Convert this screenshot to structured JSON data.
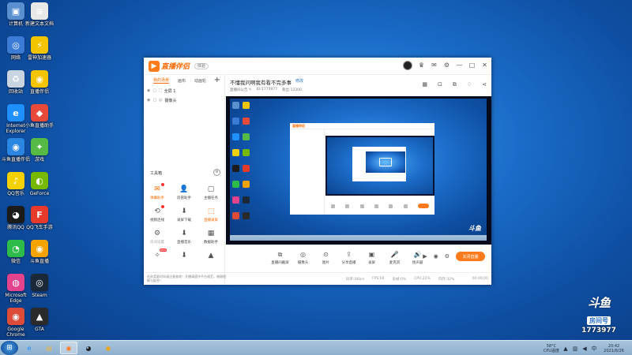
{
  "desktop": {
    "icons": [
      {
        "label": "计算机",
        "icon": "computer-icon",
        "color": "#5a8fd0",
        "glyph": "▣"
      },
      {
        "label": "新建文本文档",
        "icon": "text-doc-icon",
        "color": "#e8e8e8",
        "glyph": "≡"
      },
      {
        "label": "网络",
        "icon": "network-icon",
        "color": "#3a7bd5",
        "glyph": "◎"
      },
      {
        "label": "雷神加速器",
        "icon": "leishen-icon",
        "color": "#f3c400",
        "glyph": "⚡"
      },
      {
        "label": "回收站",
        "icon": "recycle-bin-icon",
        "color": "#c9d6e2",
        "glyph": "♻"
      },
      {
        "label": "直播伴侣",
        "icon": "live-companion-icon",
        "color": "#f5c400",
        "glyph": "◉"
      },
      {
        "label": "Internet Explorer",
        "icon": "ie-icon",
        "color": "#1e90ff",
        "glyph": "e"
      },
      {
        "label": "小鱼直播助手",
        "icon": "fish-live-icon",
        "color": "#e84a3a",
        "glyph": "◆"
      },
      {
        "label": "斗鱼直播伴侣",
        "icon": "douyu-companion-icon",
        "color": "#2a86e0",
        "glyph": "◉"
      },
      {
        "label": "游戏",
        "icon": "game-icon",
        "color": "#55bb44",
        "glyph": "✦"
      },
      {
        "label": "QQ音乐",
        "icon": "qq-music-icon",
        "color": "#f3d000",
        "glyph": "♪"
      },
      {
        "label": "GeForce",
        "icon": "geforce-icon",
        "color": "#76b900",
        "glyph": "◐"
      },
      {
        "label": "腾讯QQ",
        "icon": "qq-icon",
        "color": "#1b1b1b",
        "glyph": "◕"
      },
      {
        "label": "QQ飞车手游",
        "icon": "qq-speed-icon",
        "color": "#e83a2a",
        "glyph": "F"
      },
      {
        "label": "微信",
        "icon": "wechat-icon",
        "color": "#2dbb4a",
        "glyph": "◔"
      },
      {
        "label": "斗鱼直播",
        "icon": "douyu-icon",
        "color": "#f5a300",
        "glyph": "◉"
      },
      {
        "label": "Microsoft Edge",
        "icon": "edge-icon",
        "color": "#e3428c",
        "glyph": "◍"
      },
      {
        "label": "Steam",
        "icon": "steam-icon",
        "color": "#1b2838",
        "glyph": "◎"
      },
      {
        "label": "Google Chrome",
        "icon": "chrome-icon",
        "color": "#dd4b39",
        "glyph": "◉"
      },
      {
        "label": "GTA",
        "icon": "gta-icon",
        "color": "#2a2a2a",
        "glyph": "▲"
      }
    ]
  },
  "watermark": {
    "logo": "斗鱼",
    "room_tag": "房间号",
    "room_number": "1773977"
  },
  "taskbar": {
    "apps": [
      {
        "icon": "ie-taskbar-icon",
        "glyph": "e",
        "color": "#1e90ff"
      },
      {
        "icon": "folder-taskbar-icon",
        "glyph": "▤",
        "color": "#e8b64a"
      },
      {
        "icon": "live-companion-taskbar-icon",
        "glyph": "◉",
        "color": "#ff7a1a",
        "active": true
      },
      {
        "icon": "qq-taskbar-icon",
        "glyph": "◕",
        "color": "#222"
      },
      {
        "icon": "douyu-taskbar-icon",
        "glyph": "◉",
        "color": "#f5a300"
      }
    ],
    "cpu_temp": "58°C",
    "cpu_label": "CPU温度",
    "time": "20:42",
    "date": "2021/6/26"
  },
  "app": {
    "name": "直播伴侣",
    "version_badge": "体验",
    "left_tabs": [
      "我的场景",
      "画布",
      "动画轮"
    ],
    "scenes": [
      {
        "name": "全屏 1"
      },
      {
        "name": "摄像头"
      }
    ],
    "toolbox_title": "工具箱",
    "tools": [
      {
        "label": "弹幕助手",
        "glyph": "✉",
        "hot": true,
        "badge": "dot"
      },
      {
        "label": "房管助手",
        "glyph": "👤"
      },
      {
        "label": "主播任务",
        "glyph": "▢"
      },
      {
        "label": "视频连线",
        "glyph": "⟲",
        "badge": "dot"
      },
      {
        "label": "录屏下载",
        "glyph": "⬇"
      },
      {
        "label": "直播录屏",
        "glyph": "⬚",
        "hot": true
      },
      {
        "label": "房间设置",
        "glyph": "⚙",
        "dim": true
      },
      {
        "label": "直播音乐",
        "glyph": "⬇"
      },
      {
        "label": "数据助手",
        "glyph": "▦"
      },
      {
        "label": "",
        "glyph": "✧",
        "badge": "new",
        "badge_text": "NEW"
      },
      {
        "label": "",
        "glyph": "⬇"
      },
      {
        "label": "",
        "glyph": "▲"
      }
    ],
    "stream": {
      "title": "不懂我问啊我有看不完多事",
      "edit": "修改",
      "meta": [
        "直播间公告 ✎",
        "ID:1773977",
        "粉丝:12300"
      ]
    },
    "controls": [
      {
        "label": "直播间截屏",
        "glyph": "⧉"
      },
      {
        "label": "摄像头",
        "glyph": "◎"
      },
      {
        "label": "图片",
        "glyph": "⊙"
      },
      {
        "label": "分享直播",
        "glyph": "⇪"
      },
      {
        "label": "录屏",
        "glyph": "▣"
      },
      {
        "label": "麦克风",
        "glyph": "🎤"
      },
      {
        "label": "扬声器",
        "glyph": "🔊"
      }
    ],
    "go_live": "关闭直播",
    "notice": "任务奖励时间请注意查收！开播请遵守平台规范，谢谢理解与配合！",
    "stats": [
      "码率:0Kb/s",
      "FPS:60",
      "丢帧:0%",
      "CPU:22%",
      "内存:32%"
    ],
    "live_time": "00:00:00"
  },
  "colors": {
    "accent": "#ff7a1a",
    "desktop_blue": "#1a6cc8"
  }
}
